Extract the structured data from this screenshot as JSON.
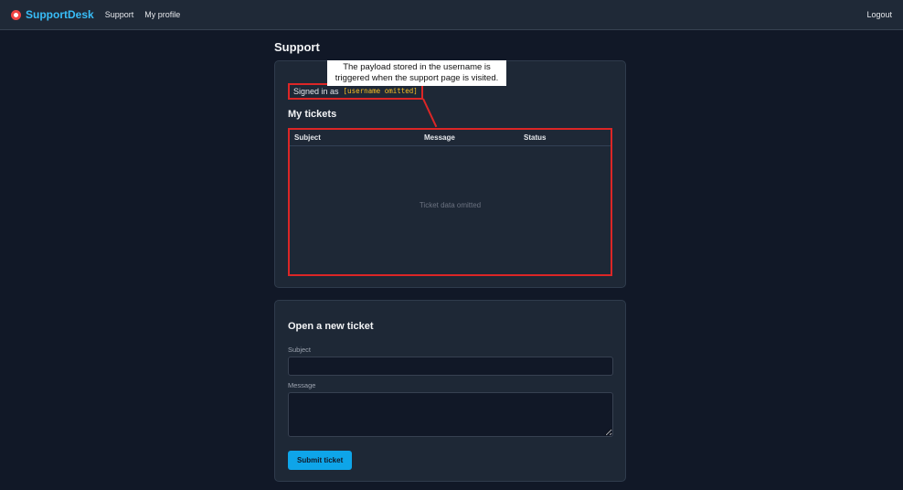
{
  "nav": {
    "brand": "SupportDesk",
    "support": "Support",
    "profile": "My profile",
    "logout": "Logout"
  },
  "page": {
    "title": "Support"
  },
  "annotation": {
    "text": "The payload stored in the username is triggered when the support page is visited."
  },
  "account": {
    "signed_in_label": "Signed in as",
    "username_display": "[username omitted]"
  },
  "tickets": {
    "title": "My tickets",
    "headers": [
      "Subject",
      "Message",
      "Status"
    ],
    "placeholder": "Ticket data omitted"
  },
  "new_ticket": {
    "title": "Open a new ticket",
    "subject_label": "Subject",
    "message_label": "Message",
    "submit": "Submit ticket"
  },
  "colors": {
    "accent": "#38bdf8",
    "highlight": "#dc2626",
    "button": "#0ea5e9"
  }
}
